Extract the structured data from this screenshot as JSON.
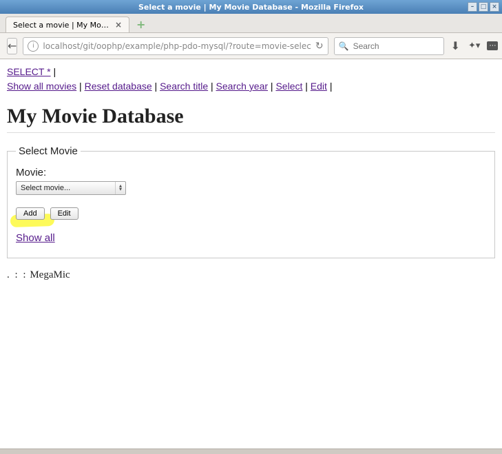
{
  "window": {
    "title": "Select a movie | My Movie Database - Mozilla Firefox"
  },
  "tab": {
    "label": "Select a movie | My Movie D..."
  },
  "address": {
    "url": "localhost/git/oophp/example/php-pdo-mysql/?route=movie-selec"
  },
  "search": {
    "placeholder": "Search"
  },
  "nav": {
    "select_star": "SELECT *",
    "show_all_movies": "Show all movies",
    "reset_database": "Reset database",
    "search_title": "Search title",
    "search_year": "Search year",
    "select": "Select",
    "edit": "Edit"
  },
  "heading": "My Movie Database",
  "fieldset": {
    "legend": "Select Movie",
    "movie_label": "Movie:",
    "dropdown_placeholder": "Select movie...",
    "add": "Add",
    "edit": "Edit",
    "show_all": "Show all"
  },
  "footer": {
    "dots": ". : :",
    "text": "MegaMic"
  }
}
